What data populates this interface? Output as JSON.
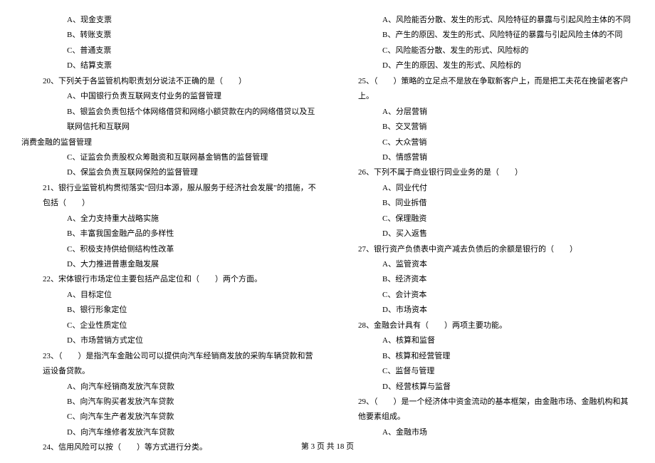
{
  "left": {
    "opts_pre": [
      "A、现金支票",
      "B、转账支票",
      "C、普通支票",
      "D、结算支票"
    ],
    "q20": "20、下列关于各监管机构职责划分说法不正确的是（　　）",
    "q20_opts": [
      "A、中国银行负责互联网支付业务的监督管理",
      "B、银监会负责包括个体网络借贷和网络小额贷款在内的网络借贷以及互联网信托和互联网"
    ],
    "q20_cont": "消费金融的监督管理",
    "q20_opts2": [
      "C、证监会负责股权众筹融资和互联网基金销售的监督管理",
      "D、保监会负责互联网保险的监督管理"
    ],
    "q21": "21、银行业监管机构贯彻落实“回归本源，服从服务于经济社会发展”的措施，不包括（　　）",
    "q21_opts": [
      "A、全力支持重大战略实施",
      "B、丰富我国金融产品的多样性",
      "C、积极支持供给侧结构性改革",
      "D、大力推进普惠金融发展"
    ],
    "q22": "22、宋体银行市场定位主要包括产品定位和（　　）两个方面。",
    "q22_opts": [
      "A、目标定位",
      "B、银行形象定位",
      "C、企业性质定位",
      "D、市场营销方式定位"
    ],
    "q23": "23、（　　）是指汽车金融公司可以提供向汽车经销商发放的采购车辆贷款和营运设备贷款。",
    "q23_opts": [
      "A、向汽车经销商发放汽车贷款",
      "B、向汽车购买者发放汽车贷款",
      "C、向汽车生产者发放汽车贷款",
      "D、向汽车维修者发放汽车贷款"
    ],
    "q24": "24、信用风险可以按（　　）等方式进行分类。"
  },
  "right": {
    "opts_pre": [
      "A、风险能否分散、发生的形式、风险特征的暴露与引起风险主体的不同",
      "B、产生的原因、发生的形式、风险特征的暴露与引起风险主体的不同",
      "C、风险能否分散、发生的形式、风险标的",
      "D、产生的原因、发生的形式、风险标的"
    ],
    "q25": "25、（　　）策略的立足点不是放在争取新客户上，而是把工夫花在挽留老客户上。",
    "q25_opts": [
      "A、分层营销",
      "B、交叉营销",
      "C、大众营销",
      "D、情感营销"
    ],
    "q26": "26、下列不属于商业银行同业业务的是（　　）",
    "q26_opts": [
      "A、同业代付",
      "B、同业拆借",
      "C、保理融资",
      "D、买入返售"
    ],
    "q27": "27、银行资产负债表中资产减去负债后的余额是银行的（　　）",
    "q27_opts": [
      "A、监管资本",
      "B、经济资本",
      "C、会计资本",
      "D、市场资本"
    ],
    "q28": "28、金融会计具有（　　）两项主要功能。",
    "q28_opts": [
      "A、核算和监督",
      "B、核算和经营管理",
      "C、监督与管理",
      "D、经营核算与监督"
    ],
    "q29": "29、（　　）是一个经济体中资金流动的基本框架，由金融市场、金融机构和其他要素组成。",
    "q29_opts": [
      "A、金融市场"
    ]
  },
  "footer": "第 3 页 共 18 页"
}
